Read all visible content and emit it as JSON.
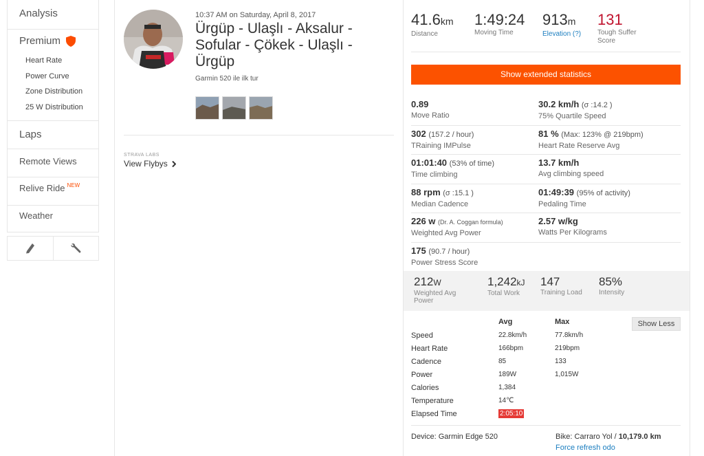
{
  "sidebar": {
    "analysis": "Analysis",
    "premium": "Premium",
    "premium_items": [
      "Heart Rate",
      "Power Curve",
      "Zone Distribution",
      "25 W Distribution"
    ],
    "laps": "Laps",
    "remote_views": "Remote Views",
    "relive_ride": "Relive Ride",
    "relive_badge": "NEW",
    "weather": "Weather",
    "tools": [
      "pencil-icon",
      "wrench-icon"
    ]
  },
  "activity": {
    "datetime": "10:37 AM on Saturday, April 8, 2017",
    "title": "Ürgüp - Ulaşlı - Aksalur - Sofular - Çökek - Ulaşlı - Ürgüp",
    "device_note": "Garmin 520 ile ilk tur",
    "labs": "STRAVA LABS",
    "flybys": "View Flybys"
  },
  "top_stats": [
    {
      "value": "41.6",
      "unit": "km",
      "label": "Distance"
    },
    {
      "value": "1:49:24",
      "unit": "",
      "label": "Moving Time"
    },
    {
      "value": "913",
      "unit": "m",
      "label": "Elevation (?)"
    },
    {
      "value": "131",
      "unit": "",
      "label": "Tough Suffer Score"
    }
  ],
  "extended_button": "Show extended statistics",
  "grid": [
    [
      {
        "value": "0.89",
        "note": "",
        "label": "Move Ratio"
      },
      {
        "value": "30.2 km/h",
        "note": "(σ :14.2 )",
        "label": "75% Quartile Speed"
      }
    ],
    [
      {
        "value": "302",
        "note": "(157.2 / hour)",
        "label": "TRaining IMPulse"
      },
      {
        "value": "81 %",
        "note": "(Max: 123% @ 219bpm)",
        "label": "Heart Rate Reserve Avg"
      }
    ],
    [
      {
        "value": "01:01:40",
        "note": "(53% of time)",
        "label": "Time climbing"
      },
      {
        "value": "13.7 km/h",
        "note": "",
        "label": "Avg climbing speed"
      }
    ],
    [
      {
        "value": "88 rpm",
        "note": "(σ :15.1 )",
        "label": "Median Cadence"
      },
      {
        "value": "01:49:39",
        "note": "(95% of activity)",
        "label": "Pedaling Time"
      }
    ],
    [
      {
        "value": "226 w",
        "note": "(Dr. A. Coggan formula)",
        "label": "Weighted Avg Power"
      },
      {
        "value": "2.57 w/kg",
        "note": "",
        "label": "Watts Per Kilograms"
      }
    ],
    [
      {
        "value": "175",
        "note": "(90.7 / hour)",
        "label": "Power Stress Score"
      }
    ]
  ],
  "power_stats": [
    {
      "value": "212",
      "unit": "W",
      "label": "Weighted Avg Power"
    },
    {
      "value": "1,242",
      "unit": "kJ",
      "label": "Total Work"
    },
    {
      "value": "147",
      "unit": "",
      "label": "Training Load"
    },
    {
      "value": "85%",
      "unit": "",
      "label": "Intensity"
    }
  ],
  "show_less": "Show Less",
  "metrics": {
    "head": [
      "",
      "Avg",
      "Max"
    ],
    "rows": [
      [
        "Speed",
        "22.8km/h",
        "77.8km/h"
      ],
      [
        "Heart Rate",
        "166bpm",
        "219bpm"
      ],
      [
        "Cadence",
        "85",
        "133"
      ],
      [
        "Power",
        "189W",
        "1,015W"
      ],
      [
        "Calories",
        "1,384",
        ""
      ],
      [
        "Temperature",
        "14℃",
        ""
      ],
      [
        "Elapsed Time",
        "2:05:10",
        ""
      ]
    ]
  },
  "footer": {
    "device": "Device: Garmin Edge 520",
    "bike_prefix": "Bike: Carraro Yol / ",
    "bike_odo": "10,179.0 km",
    "refresh": "Force refresh odo"
  },
  "colors": {
    "accent": "#fc5200",
    "link": "#1a7dbf",
    "suffer": "#c0132e"
  }
}
